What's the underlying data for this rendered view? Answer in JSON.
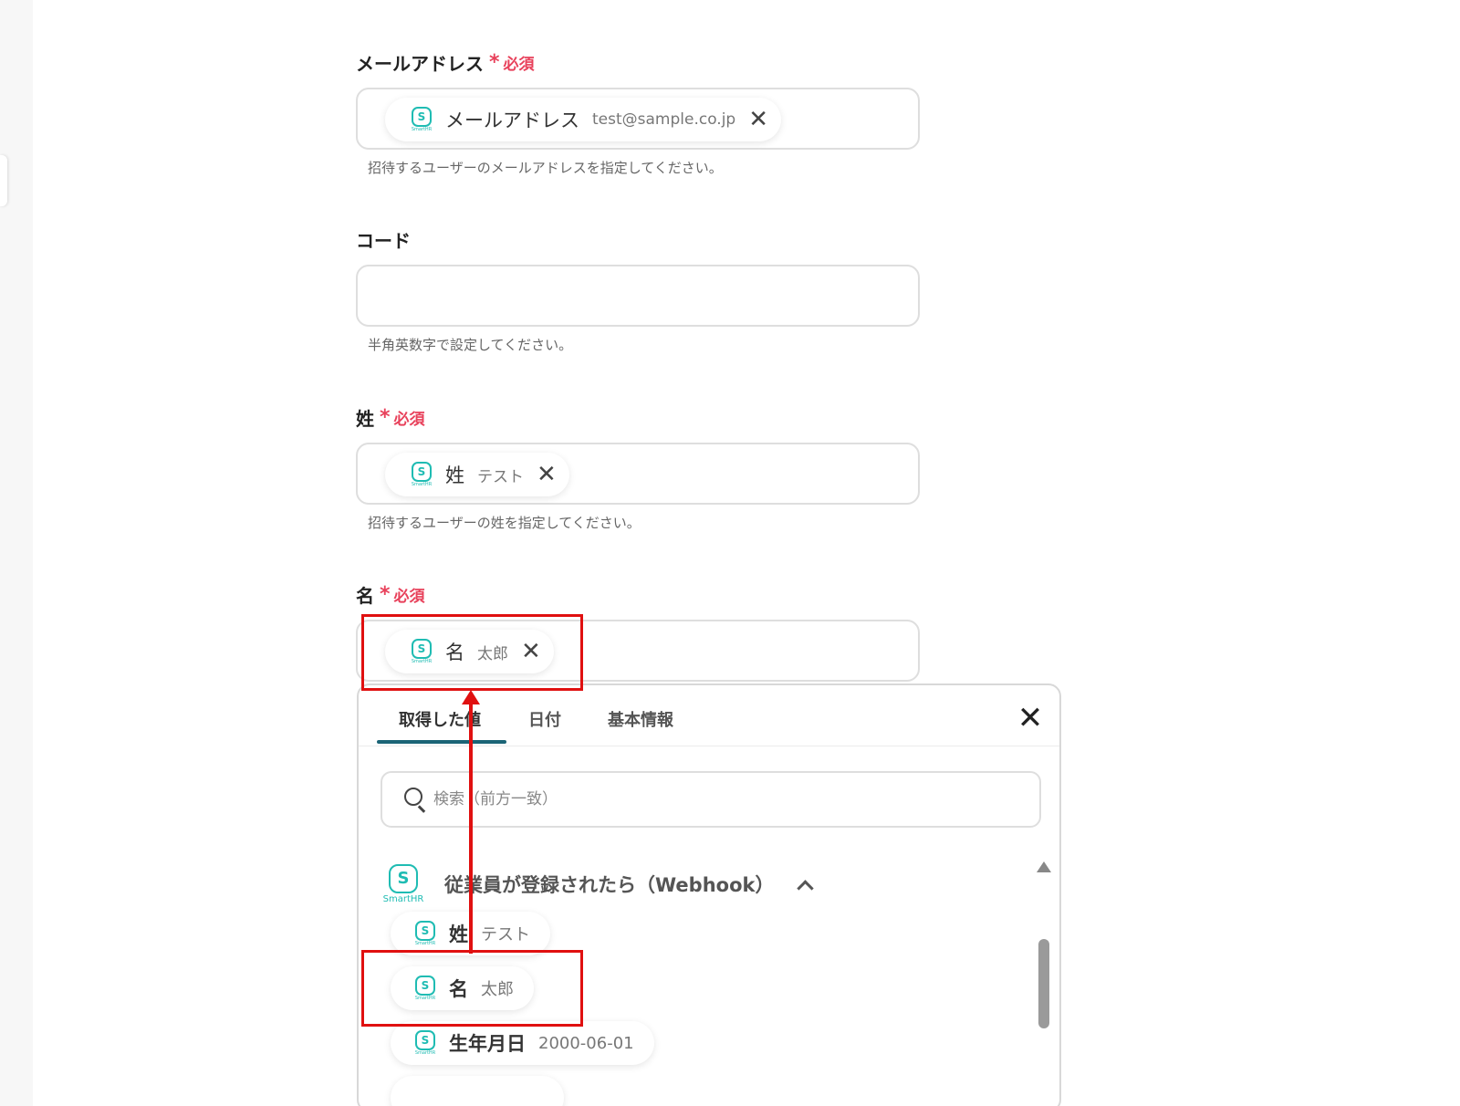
{
  "required_mark": "必須",
  "fields": {
    "email": {
      "label": "メールアドレス",
      "chip": {
        "name": "メールアドレス",
        "value": "test@sample.co.jp"
      },
      "hint": "招待するユーザーのメールアドレスを指定してください。"
    },
    "code": {
      "label": "コード",
      "value": "",
      "hint": "半角英数字で設定してください。"
    },
    "last_name": {
      "label": "姓",
      "chip": {
        "name": "姓",
        "value": "テスト"
      },
      "hint": "招待するユーザーの姓を指定してください。"
    },
    "first_name": {
      "label": "名",
      "chip": {
        "name": "名",
        "value": "太郎"
      }
    }
  },
  "popup": {
    "tabs": [
      {
        "label": "取得した値",
        "active": true
      },
      {
        "label": "日付",
        "active": false
      },
      {
        "label": "基本情報",
        "active": false
      }
    ],
    "search_placeholder": "検索（前方一致）",
    "group": {
      "app": "SmartHR",
      "title": "従業員が登録されたら（Webhook）",
      "expanded": true
    },
    "options": [
      {
        "name": "姓",
        "value": "テスト"
      },
      {
        "name": "名",
        "value": "太郎"
      },
      {
        "name": "生年月日",
        "value": "2000-06-01"
      }
    ]
  },
  "icons": {
    "app_logo": "smarthr-logo-icon",
    "remove": "close-icon",
    "search": "search-icon",
    "collapse": "chevron-up-icon"
  },
  "colors": {
    "required": "#e8415b",
    "brand": "#1fbcb3",
    "tab_underline": "#1a6476",
    "annotation": "#e01010"
  }
}
